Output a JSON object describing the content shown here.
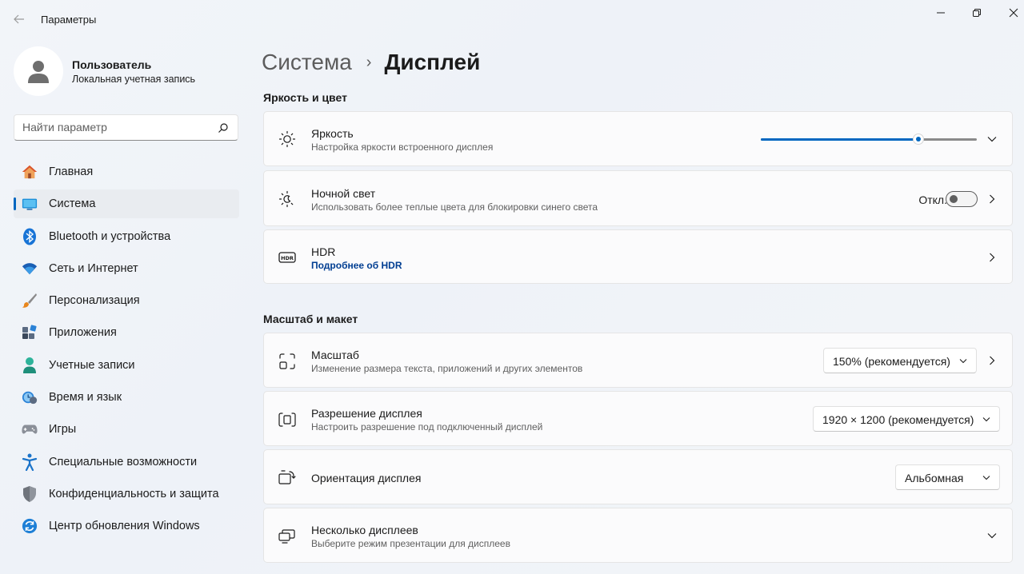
{
  "window": {
    "title": "Параметры"
  },
  "profile": {
    "name": "Пользователь",
    "account_type": "Локальная учетная запись"
  },
  "search": {
    "placeholder": "Найти параметр"
  },
  "sidebar": {
    "items": [
      {
        "label": "Главная",
        "icon": "home-icon",
        "active": false
      },
      {
        "label": "Система",
        "icon": "system-icon",
        "active": true
      },
      {
        "label": "Bluetooth и устройства",
        "icon": "bluetooth-icon",
        "active": false
      },
      {
        "label": "Сеть и Интернет",
        "icon": "wifi-icon",
        "active": false
      },
      {
        "label": "Персонализация",
        "icon": "brush-icon",
        "active": false
      },
      {
        "label": "Приложения",
        "icon": "apps-icon",
        "active": false
      },
      {
        "label": "Учетные записи",
        "icon": "accounts-icon",
        "active": false
      },
      {
        "label": "Время и язык",
        "icon": "time-language-icon",
        "active": false
      },
      {
        "label": "Игры",
        "icon": "gamepad-icon",
        "active": false
      },
      {
        "label": "Специальные возможности",
        "icon": "accessibility-icon",
        "active": false
      },
      {
        "label": "Конфиденциальность и защита",
        "icon": "shield-icon",
        "active": false
      },
      {
        "label": "Центр обновления Windows",
        "icon": "update-icon",
        "active": false
      }
    ]
  },
  "breadcrumb": {
    "parent": "Система",
    "separator": "›",
    "current": "Дисплей"
  },
  "sections": {
    "brightness_color": {
      "title": "Яркость и цвет",
      "brightness": {
        "title": "Яркость",
        "subtitle": "Настройка яркости встроенного дисплея",
        "value_fraction": 0.73
      },
      "night_light": {
        "title": "Ночной свет",
        "subtitle": "Использовать более теплые цвета для блокировки синего света",
        "state_label": "Откл.",
        "on": false
      },
      "hdr": {
        "title": "HDR",
        "link": "Подробнее об HDR"
      }
    },
    "scale_layout": {
      "title": "Масштаб и макет",
      "scale": {
        "title": "Масштаб",
        "subtitle": "Изменение размера текста, приложений и других элементов",
        "value": "150% (рекомендуется)"
      },
      "resolution": {
        "title": "Разрешение дисплея",
        "subtitle": "Настроить разрешение под подключенный дисплей",
        "value": "1920 × 1200 (рекомендуется)"
      },
      "orientation": {
        "title": "Ориентация дисплея",
        "value": "Альбомная"
      },
      "multiple_displays": {
        "title": "Несколько дисплеев",
        "subtitle": "Выберите режим презентации для дисплеев"
      }
    }
  },
  "colors": {
    "accent": "#0067c0",
    "link": "#003e92"
  }
}
